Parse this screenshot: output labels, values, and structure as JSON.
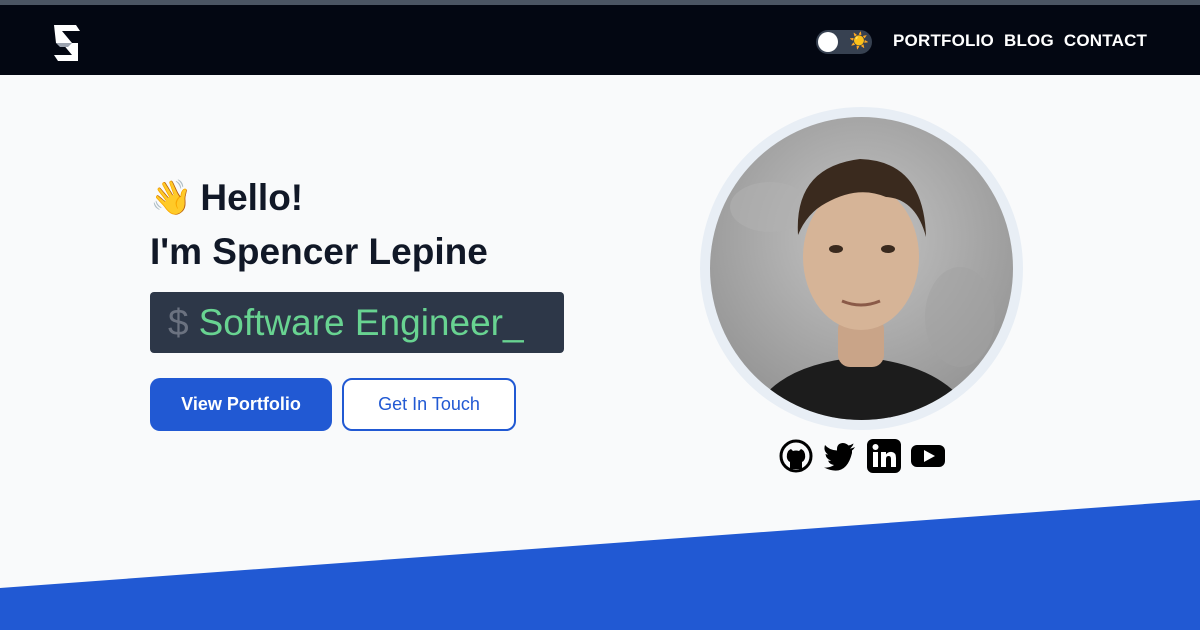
{
  "nav": {
    "links": [
      "PORTFOLIO",
      "BLOG",
      "CONTACT"
    ],
    "theme_icon": "sun-icon"
  },
  "hero": {
    "wave_emoji": "👋",
    "greeting": "Hello!",
    "intro": "I'm Spencer Lepine",
    "prompt_symbol": "$",
    "role": "Software Engineer_",
    "primary_button": "View Portfolio",
    "secondary_button": "Get In Touch"
  },
  "socials": [
    "github-icon",
    "twitter-icon",
    "linkedin-icon",
    "youtube-icon"
  ],
  "colors": {
    "nav_bg": "#030712",
    "accent": "#2159d3",
    "terminal_bg": "#2d3748",
    "terminal_text": "#68d391",
    "page_bg": "#f9fafb"
  }
}
